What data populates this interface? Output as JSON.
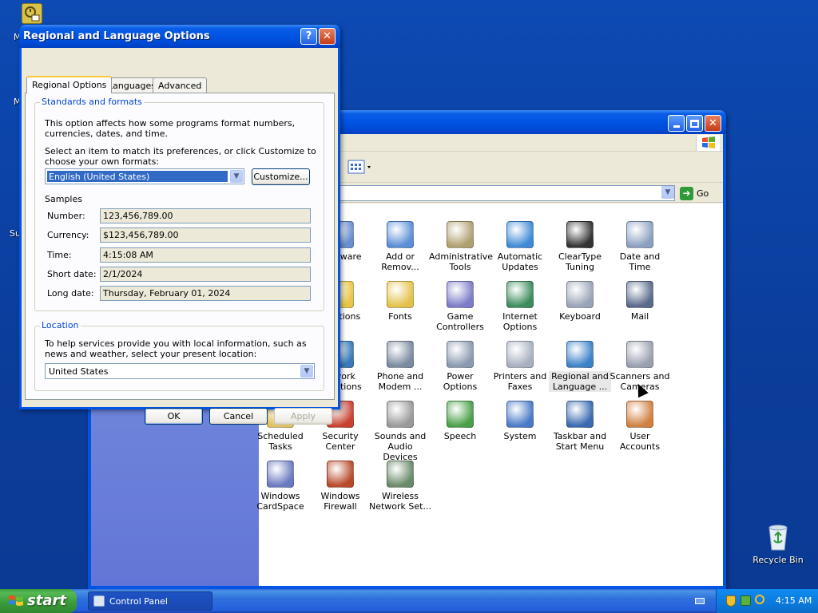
{
  "desktop": {
    "letters": [
      "M",
      "M",
      "Su"
    ],
    "recycle_bin_label": "Recycle Bin"
  },
  "control_panel": {
    "address_go_label": "Go",
    "items": [
      {
        "label1": "Hardware",
        "label2": "",
        "icon": "printer-scanner-icon",
        "color": "#6a8fcf"
      },
      {
        "label1": "Add or",
        "label2": "Remov...",
        "icon": "add-remove-programs-icon",
        "color": "#5a8ed6"
      },
      {
        "label1": "Administrative",
        "label2": "Tools",
        "icon": "admin-tools-icon",
        "color": "#b0a070"
      },
      {
        "label1": "Automatic",
        "label2": "Updates",
        "icon": "windows-update-icon",
        "color": "#3f8ad6"
      },
      {
        "label1": "ClearType",
        "label2": "Tuning",
        "icon": "cleartype-icon",
        "color": "#333333"
      },
      {
        "label1": "Date and Time",
        "label2": "",
        "icon": "clock-icon",
        "color": "#8aa0c0"
      },
      {
        "label1": "r Options",
        "label2": "",
        "icon": "folder-options-icon",
        "color": "#e8c64a"
      },
      {
        "label1": "Fonts",
        "label2": "",
        "icon": "fonts-folder-icon",
        "color": "#e4c24a"
      },
      {
        "label1": "Game",
        "label2": "Controllers",
        "icon": "gamepad-icon",
        "color": "#7c7cc8"
      },
      {
        "label1": "Internet",
        "label2": "Options",
        "icon": "globe-icon",
        "color": "#3c8c5c"
      },
      {
        "label1": "Keyboard",
        "label2": "",
        "icon": "keyboard-icon",
        "color": "#9aa4b8"
      },
      {
        "label1": "Mail",
        "label2": "",
        "icon": "mail-icon",
        "color": "#5a6a8a"
      },
      {
        "label1": "etwork",
        "label2": "nnections",
        "icon": "network-icon",
        "color": "#3a7ab8"
      },
      {
        "label1": "Phone and",
        "label2": "Modem ...",
        "icon": "phone-modem-icon",
        "color": "#7a8aa0"
      },
      {
        "label1": "Power Options",
        "label2": "",
        "icon": "power-icon",
        "color": "#8a9ab0"
      },
      {
        "label1": "Printers and",
        "label2": "Faxes",
        "icon": "printer-icon",
        "color": "#a8b0c0"
      },
      {
        "label1": "Regional and",
        "label2": "Language ...",
        "icon": "regional-globe-icon",
        "color": "#3c82c8"
      },
      {
        "label1": "Scanners and",
        "label2": "Cameras",
        "icon": "scanner-camera-icon",
        "color": "#9aa0b0"
      },
      {
        "label1": "Scheduled",
        "label2": "Tasks",
        "icon": "scheduled-tasks-icon",
        "color": "#e0c060"
      },
      {
        "label1": "Security",
        "label2": "Center",
        "icon": "shield-icon",
        "color": "#c84030"
      },
      {
        "label1": "Sounds and",
        "label2": "Audio Devices",
        "icon": "speaker-icon",
        "color": "#9a9a9a"
      },
      {
        "label1": "Speech",
        "label2": "",
        "icon": "speech-icon",
        "color": "#4aa04a"
      },
      {
        "label1": "System",
        "label2": "",
        "icon": "system-icon",
        "color": "#4a7ac8"
      },
      {
        "label1": "Taskbar and",
        "label2": "Start Menu",
        "icon": "taskbar-icon",
        "color": "#3a6ab0"
      },
      {
        "label1": "User Accounts",
        "label2": "",
        "icon": "users-icon",
        "color": "#d08040"
      },
      {
        "label1": "Windows",
        "label2": "CardSpace",
        "icon": "cardspace-icon",
        "color": "#6a7ac0"
      },
      {
        "label1": "Windows",
        "label2": "Firewall",
        "icon": "firewall-icon",
        "color": "#b84a2a"
      },
      {
        "label1": "Wireless",
        "label2": "Network Set...",
        "icon": "wireless-icon",
        "color": "#6a8a6a"
      }
    ]
  },
  "dialog": {
    "title": "Regional and Language Options",
    "help_btn": "?",
    "close_btn": "✕",
    "tabs": [
      "Regional Options",
      "Languages",
      "Advanced"
    ],
    "standards": {
      "title": "Standards and formats",
      "desc": "This option affects how some programs format numbers, currencies, dates, and time.",
      "select_text": "Select an item to match its preferences, or click Customize to choose your own formats:",
      "selected_locale": "English (United States)",
      "customize_label": "Customize...",
      "samples_label": "Samples",
      "samples": [
        {
          "label": "Number:",
          "value": "123,456,789.00"
        },
        {
          "label": "Currency:",
          "value": "$123,456,789.00"
        },
        {
          "label": "Time:",
          "value": "4:15:08 AM"
        },
        {
          "label": "Short date:",
          "value": "2/1/2024"
        },
        {
          "label": "Long date:",
          "value": "Thursday, February 01, 2024"
        }
      ]
    },
    "location": {
      "title": "Location",
      "desc": "To help services provide you with local information, such as news and weather, select your present location:",
      "selected": "United States"
    },
    "buttons": {
      "ok": "OK",
      "cancel": "Cancel",
      "apply": "Apply"
    }
  },
  "taskbar": {
    "start_label": "start",
    "task_label": "Control Panel",
    "clock": "4:15 AM"
  }
}
